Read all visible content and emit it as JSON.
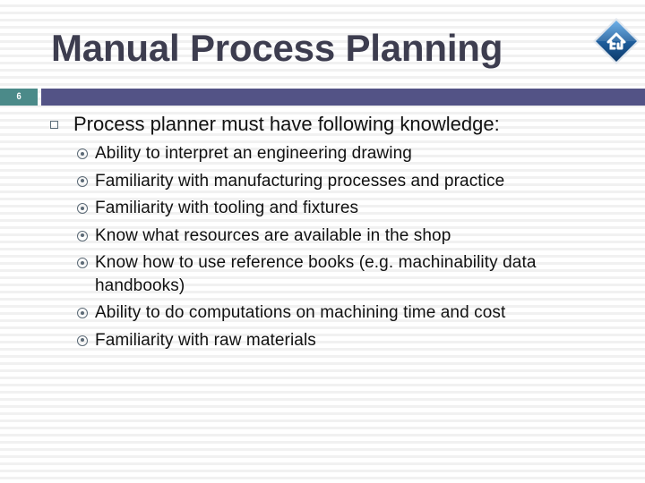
{
  "slide": {
    "title": "Manual Process Planning",
    "slide_number": "6",
    "home_icon": "home-icon",
    "colors": {
      "title": "#3d3d4f",
      "number_box": "#4b8a89",
      "header_bar": "#535386",
      "bullet": "#5c6a76"
    },
    "bullet_level1": {
      "icon": "hollow-square",
      "text": "Process planner must have following knowledge:"
    },
    "bullets_level2_icon": "circled-dot",
    "bullets_level2": [
      "Ability to interpret an engineering drawing",
      "Familiarity with manufacturing processes and practice",
      "Familiarity with tooling and fixtures",
      "Know what resources are available in the shop",
      "Know how to use reference books (e.g. machinability data handbooks)",
      "Ability to do computations on machining time and cost",
      "Familiarity with raw materials"
    ]
  }
}
